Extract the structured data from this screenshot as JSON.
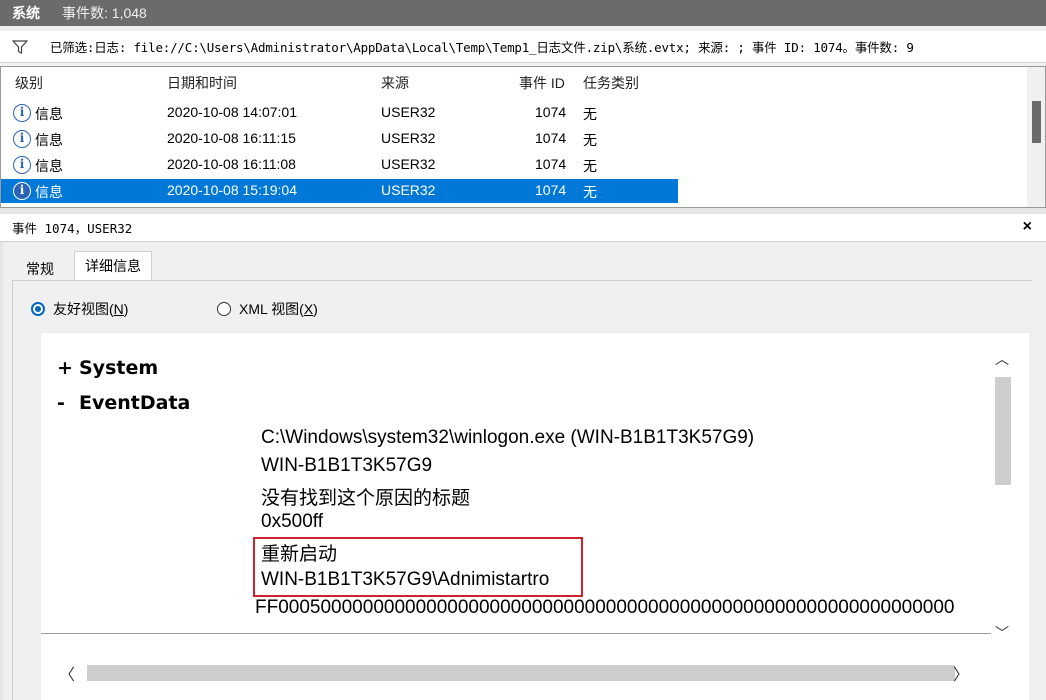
{
  "titlebar": {
    "name": "系统",
    "count": "事件数: 1,048"
  },
  "filter": {
    "text": "已筛选:日志: file://C:\\Users\\Administrator\\AppData\\Local\\Temp\\Temp1_日志文件.zip\\系统.evtx; 来源: ; 事件 ID: 1074。事件数: 9"
  },
  "list": {
    "columns": {
      "level": "级别",
      "datetime": "日期和时间",
      "source": "来源",
      "event_id": "事件 ID",
      "category": "任务类别"
    },
    "rows": [
      {
        "level": "信息",
        "datetime": "2020-10-08 14:07:01",
        "source": "USER32",
        "event_id": "1074",
        "category": "无"
      },
      {
        "level": "信息",
        "datetime": "2020-10-08 16:11:15",
        "source": "USER32",
        "event_id": "1074",
        "category": "无"
      },
      {
        "level": "信息",
        "datetime": "2020-10-08 16:11:08",
        "source": "USER32",
        "event_id": "1074",
        "category": "无"
      },
      {
        "level": "信息",
        "datetime": "2020-10-08 15:19:04",
        "source": "USER32",
        "event_id": "1074",
        "category": "无",
        "selected": true
      }
    ]
  },
  "detail": {
    "title": "事件 1074，USER32",
    "close": "×",
    "tabs": {
      "general": "常规",
      "details": "详细信息"
    },
    "radio": {
      "friendly_prefix": "友好视图(",
      "friendly_key": "N",
      "friendly_suffix": ")",
      "xml_prefix": "XML 视图(",
      "xml_key": "X",
      "xml_suffix": ")"
    },
    "tree": {
      "system": "System",
      "eventdata": "EventData",
      "plus": "+",
      "minus": "-"
    },
    "event_data": [
      "C:\\Windows\\system32\\winlogon.exe (WIN-B1B1T3K57G9)",
      "WIN-B1B1T3K57G9",
      "没有找到这个原因的标题",
      "0x500ff",
      "重新启动",
      "WIN-B1B1T3K57G9\\Adnimistartro",
      "FF0005000000000000000000000000000000000000000000000000000000000000"
    ],
    "highlight_color": "#d0222a"
  },
  "scroll": {
    "up": "︿",
    "down": "﹀",
    "left": "〈",
    "right": "〉"
  }
}
